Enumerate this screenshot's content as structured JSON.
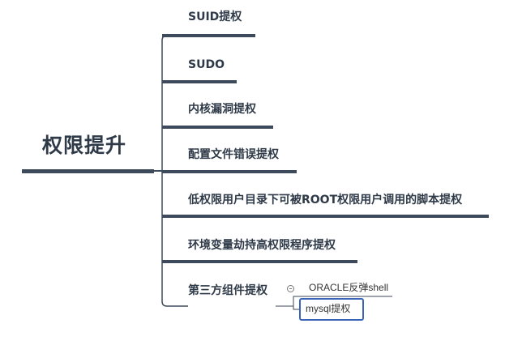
{
  "root": {
    "label": "权限提升"
  },
  "branches": [
    {
      "label": "SUID提权"
    },
    {
      "label": "SUDO"
    },
    {
      "label": "内核漏洞提权"
    },
    {
      "label": "配置文件错误提权"
    },
    {
      "label": "低权限用户目录下可被ROOT权限用户调用的脚本提权"
    },
    {
      "label": "环境变量劫持高权限程序提权"
    },
    {
      "label": "第三方组件提权"
    }
  ],
  "sub_branches": [
    {
      "label": "ORACLE反弹shell"
    },
    {
      "label": "mysql提权",
      "selected": true
    }
  ],
  "colors": {
    "connector": "#3d4a5c",
    "text": "#2f3a48",
    "selection": "#3a64b8"
  }
}
